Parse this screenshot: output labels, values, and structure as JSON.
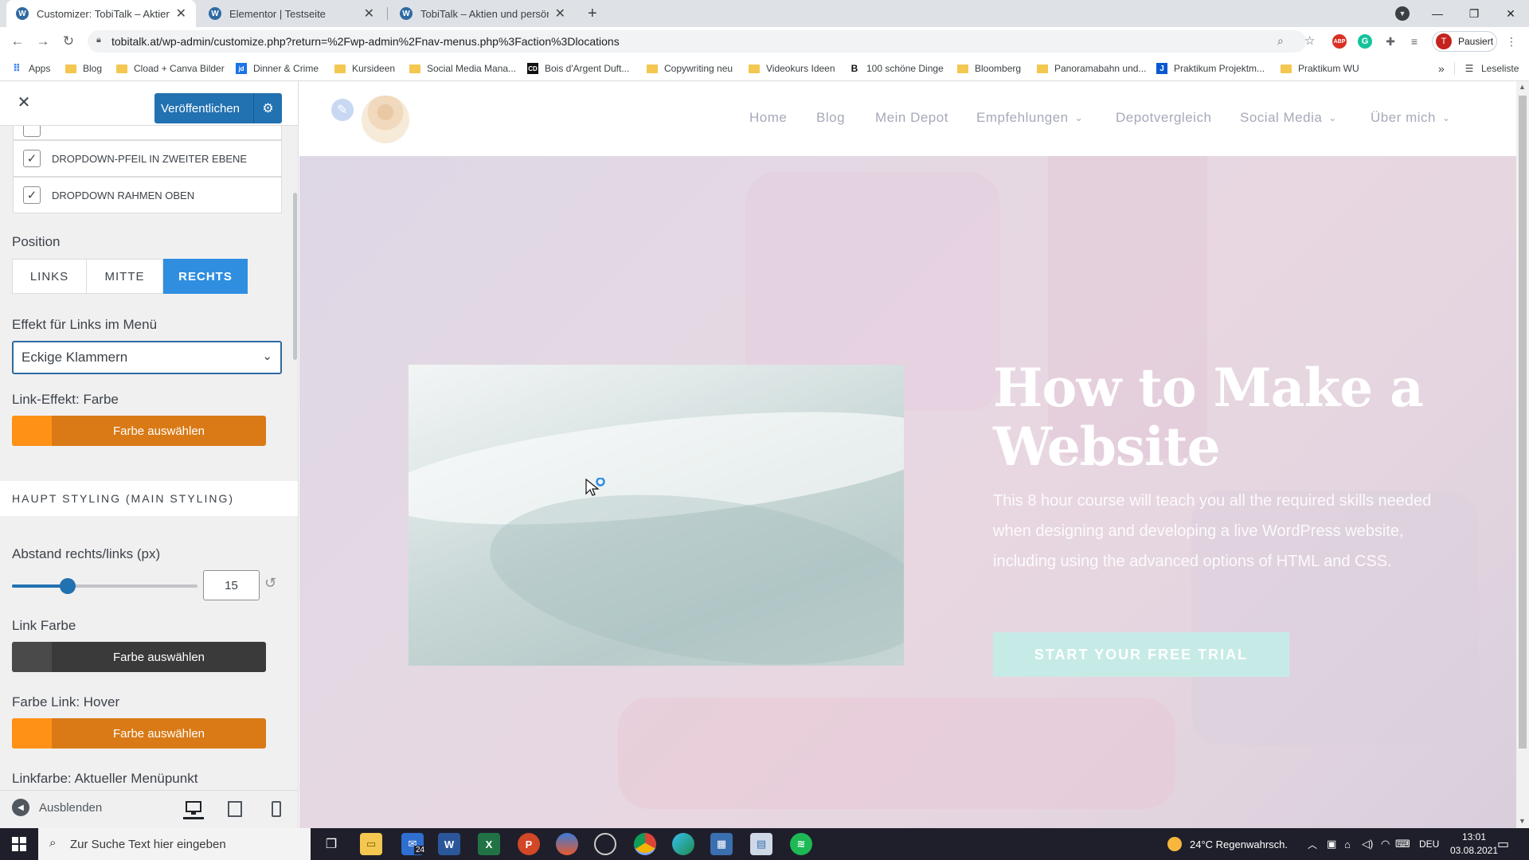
{
  "browser": {
    "tabs": [
      {
        "title": "Customizer: TobiTalk – Aktien un",
        "active": true
      },
      {
        "title": "Elementor | Testseite",
        "active": false
      },
      {
        "title": "TobiTalk – Aktien und persönliche",
        "active": false
      }
    ],
    "new_tab_symbol": "+",
    "url": "tobitalk.at/wp-admin/customize.php?return=%2Fwp-admin%2Fnav-menus.php%3Faction%3Dlocations",
    "profile_initial": "T",
    "profile_label": "Pausiert",
    "bookmarks": [
      {
        "label": "Apps",
        "icon": "apps-grid-icon"
      },
      {
        "label": "Blog",
        "icon": "folder-icon"
      },
      {
        "label": "Cload + Canva Bilder",
        "icon": "folder-icon"
      },
      {
        "label": "Dinner & Crime",
        "icon": "jd-site-icon"
      },
      {
        "label": "Kursideen",
        "icon": "folder-icon"
      },
      {
        "label": "Social Media Mana...",
        "icon": "folder-icon"
      },
      {
        "label": "Bois d'Argent Duft...",
        "icon": "dior-site-icon"
      },
      {
        "label": "Copywriting neu",
        "icon": "folder-icon"
      },
      {
        "label": "Videokurs Ideen",
        "icon": "folder-icon"
      },
      {
        "label": "100 schöne Dinge",
        "icon": "b-site-icon"
      },
      {
        "label": "Bloomberg",
        "icon": "folder-icon"
      },
      {
        "label": "Panoramabahn und...",
        "icon": "folder-icon"
      },
      {
        "label": "Praktikum Projektm...",
        "icon": "j-site-icon"
      },
      {
        "label": "Praktikum WU",
        "icon": "folder-icon"
      }
    ],
    "overflow_symbol": "»",
    "reading_list": "Leseliste"
  },
  "customizer": {
    "publish_label": "Veröffentlichen",
    "checkboxes": [
      {
        "label": "Dropdown-Pfeil in zweiter Ebene",
        "checked": true
      },
      {
        "label": "Dropdown Rahmen oben",
        "checked": true
      }
    ],
    "check_mark": "✓",
    "position_label": "Position",
    "position_options": [
      "LINKS",
      "MITTE",
      "RECHTS"
    ],
    "position_selected": "RECHTS",
    "effect_label": "Effekt für Links im Menü",
    "effect_value": "Eckige Klammern",
    "link_effect_color_label": "Link-Effekt: Farbe",
    "pick_color_label": "Farbe auswählen",
    "main_styling_heading": "Haupt Styling (Main Styling)",
    "spacing_label": "Abstand rechts/links (px)",
    "spacing_value": "15",
    "spacing_fraction": 0.3,
    "link_color_label": "Link Farbe",
    "hover_color_label": "Farbe Link: Hover",
    "current_item_label": "Linkfarbe: Aktueller Menüpunkt",
    "hide_label": "Ausblenden",
    "colors": {
      "accent_orange": "#d97a16",
      "swatch_orange": "#ff9117",
      "link_dark": "#3a3a3a",
      "swatch_dark": "#4a4a4a",
      "primary_blue": "#2271b1"
    }
  },
  "preview": {
    "nav": [
      {
        "label": "Home",
        "dropdown": false
      },
      {
        "label": "Blog",
        "dropdown": false
      },
      {
        "label": "Mein Depot",
        "dropdown": false
      },
      {
        "label": "Empfehlungen",
        "dropdown": true
      },
      {
        "label": "Depotvergleich",
        "dropdown": false
      },
      {
        "label": "Social Media",
        "dropdown": true
      },
      {
        "label": "Über mich",
        "dropdown": true
      }
    ],
    "hero_title": "How to Make a Website",
    "hero_text": "This 8 hour course will teach you all the required skills needed when designing and developing a live WordPress website, including using the advanced options of HTML and CSS.",
    "cta_label": "START YOUR FREE TRIAL"
  },
  "taskbar": {
    "search_placeholder": "Zur Suche Text hier eingeben",
    "mail_badge": "24",
    "weather": "24°C  Regenwahrsch.",
    "language": "DEU",
    "time": "13:01",
    "date": "03.08.2021"
  }
}
